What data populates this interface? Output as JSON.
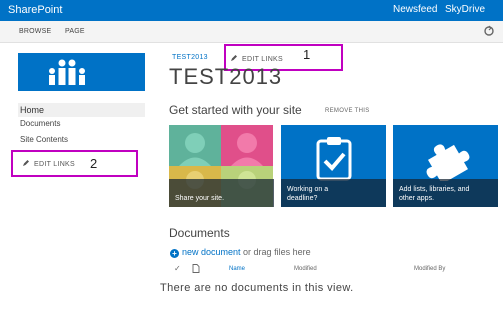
{
  "suite": {
    "brand": "SharePoint",
    "newsfeed": "Newsfeed",
    "skydrive": "SkyDrive"
  },
  "ribbon": {
    "browse": "BROWSE",
    "page": "PAGE",
    "share_icon": "share-icon"
  },
  "leftnav": {
    "items": [
      {
        "label": "Home"
      },
      {
        "label": "Documents"
      },
      {
        "label": "Site Contents"
      }
    ],
    "edit_links": "EDIT LINKS"
  },
  "header": {
    "breadcrumb": "TEST2013",
    "edit_links": "EDIT LINKS",
    "title": "TEST2013"
  },
  "callouts": {
    "one": "1",
    "two": "2",
    "color": "#c000c0"
  },
  "get_started": {
    "heading": "Get started with your site",
    "remove": "REMOVE THIS",
    "tiles": [
      {
        "caption": "Share your site.",
        "icon": "people-photo-icon"
      },
      {
        "caption_line1": "Working on a",
        "caption_line2": "deadline?",
        "icon": "clipboard-check-icon"
      },
      {
        "caption_line1": "Add lists, libraries, and",
        "caption_line2": "other apps.",
        "icon": "puzzle-piece-icon"
      }
    ]
  },
  "documents": {
    "heading": "Documents",
    "new_document": "new document",
    "drag_text": " or drag files here",
    "columns": {
      "name": "Name",
      "modified": "Modified",
      "modified_by": "Modified By"
    },
    "empty_message": "There are no documents in this view."
  },
  "colors": {
    "suitebar": "#0072c6",
    "accent": "#0072c6"
  }
}
